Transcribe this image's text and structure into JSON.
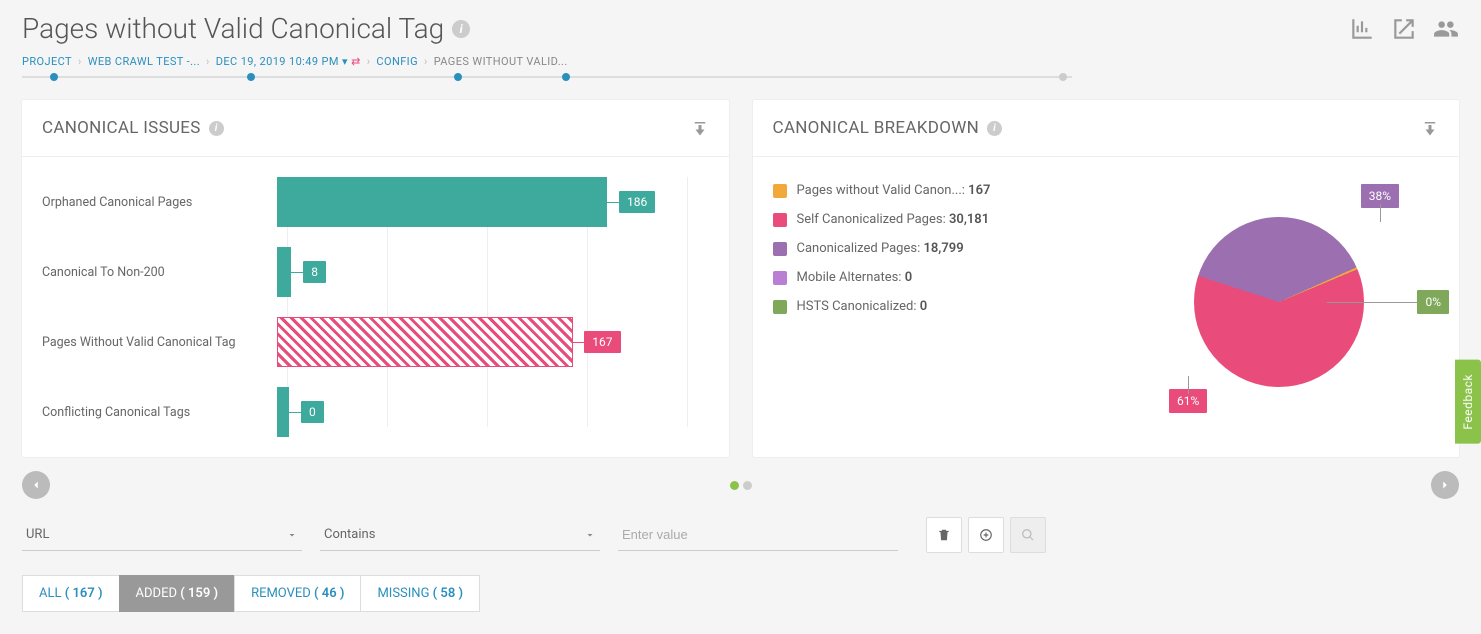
{
  "page_title": "Pages without Valid Canonical Tag",
  "breadcrumb": {
    "project": "PROJECT",
    "crawl": "WEB CRAWL TEST -...",
    "date": "DEC 19, 2019 10:49 PM",
    "config": "CONFIG",
    "current": "PAGES WITHOUT VALID..."
  },
  "panel_issues": {
    "title": "CANONICAL ISSUES",
    "bars": [
      {
        "label": "Orphaned Canonical Pages",
        "value": 186,
        "color": "teal",
        "hatch": false
      },
      {
        "label": "Canonical To Non-200",
        "value": 8,
        "color": "teal",
        "hatch": false
      },
      {
        "label": "Pages Without Valid Canonical Tag",
        "value": 167,
        "color": "pink",
        "hatch": true
      },
      {
        "label": "Conflicting Canonical Tags",
        "value": 0,
        "color": "teal",
        "hatch": false
      }
    ],
    "max": 186
  },
  "panel_breakdown": {
    "title": "CANONICAL BREAKDOWN",
    "legend": [
      {
        "label": "Pages without Valid Canon...:",
        "value": "167",
        "color": "#F2A93B"
      },
      {
        "label": "Self Canonicalized Pages:",
        "value": "30,181",
        "color": "#E94B7B"
      },
      {
        "label": "Canonicalized Pages:",
        "value": "18,799",
        "color": "#9B6FB0"
      },
      {
        "label": "Mobile Alternates:",
        "value": "0",
        "color": "#B97FD4"
      },
      {
        "label": "HSTS Canonicalized:",
        "value": "0",
        "color": "#7FA85A"
      }
    ],
    "slices": [
      {
        "pct": 61,
        "color": "#E94B7B"
      },
      {
        "pct": 38,
        "color": "#9B6FB0"
      },
      {
        "pct": 0,
        "color": "#F2A93B"
      }
    ]
  },
  "chart_data": [
    {
      "type": "bar",
      "title": "CANONICAL ISSUES",
      "orientation": "horizontal",
      "categories": [
        "Orphaned Canonical Pages",
        "Canonical To Non-200",
        "Pages Without Valid Canonical Tag",
        "Conflicting Canonical Tags"
      ],
      "values": [
        186,
        8,
        167,
        0
      ],
      "xlim": [
        0,
        200
      ]
    },
    {
      "type": "pie",
      "title": "CANONICAL BREAKDOWN",
      "series": [
        {
          "name": "Pages without Valid Canonical Tag",
          "value": 167,
          "pct": 0
        },
        {
          "name": "Self Canonicalized Pages",
          "value": 30181,
          "pct": 61
        },
        {
          "name": "Canonicalized Pages",
          "value": 18799,
          "pct": 38
        },
        {
          "name": "Mobile Alternates",
          "value": 0,
          "pct": 0
        },
        {
          "name": "HSTS Canonicalized",
          "value": 0,
          "pct": 0
        }
      ]
    }
  ],
  "filter": {
    "field": "URL",
    "operator": "Contains",
    "placeholder": "Enter value"
  },
  "tabs": [
    {
      "label": "ALL",
      "count": "( 167 )",
      "active": false
    },
    {
      "label": "ADDED",
      "count": "( 159 )",
      "active": true
    },
    {
      "label": "REMOVED",
      "count": "( 46 )",
      "active": false
    },
    {
      "label": "MISSING",
      "count": "( 58 )",
      "active": false
    }
  ],
  "feedback": "Feedback"
}
